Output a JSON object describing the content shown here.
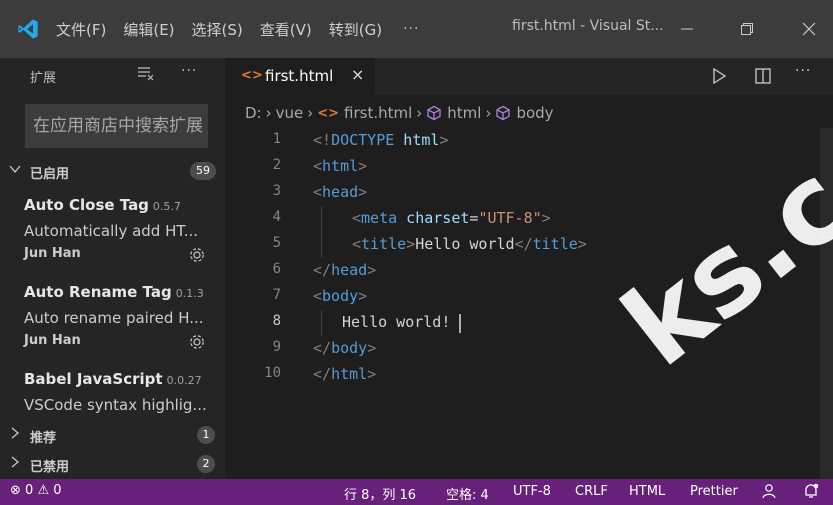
{
  "titlebar": {
    "menus": [
      "文件(F)",
      "编辑(E)",
      "选择(S)",
      "查看(V)",
      "转到(G)"
    ],
    "more": "···",
    "window_title": "first.html - Visual St...",
    "colors": {
      "background": "#3c3c3c",
      "logo": "#23a9f2"
    }
  },
  "sidebar": {
    "title": "扩展",
    "more": "···",
    "search_placeholder": "在应用商店中搜索扩展",
    "enabled_section": {
      "label": "已启用",
      "count": "59"
    },
    "extensions": [
      {
        "name": "Auto Close Tag",
        "version": "0.5.7",
        "description": "Automatically add HT...",
        "publisher": "Jun Han"
      },
      {
        "name": "Auto Rename Tag",
        "version": "0.1.3",
        "description": "Auto rename paired H...",
        "publisher": "Jun Han"
      },
      {
        "name": "Babel JavaScript",
        "version": "0.0.27",
        "description": "VSCode syntax highlig...",
        "publisher": ""
      }
    ],
    "recommended_section": {
      "label": "推荐",
      "count": "1"
    },
    "disabled_section": {
      "label": "已禁用",
      "count": "2"
    }
  },
  "tab": {
    "label": "first.html",
    "icon": "<>",
    "close": "×"
  },
  "breadcrumb": {
    "drive": "D:",
    "folder": "vue",
    "file": "first.html",
    "html": "html",
    "body": "body"
  },
  "editor": {
    "line_numbers": [
      "1",
      "2",
      "3",
      "4",
      "5",
      "6",
      "7",
      "8",
      "9",
      "10"
    ],
    "lines": {
      "l1_open": "<!",
      "l1_doctype": "DOCTYPE",
      "l1_html": " html",
      "l1_close": ">",
      "l2_open": "<",
      "l2_tag": "html",
      "l2_close": ">",
      "l3_open": "<",
      "l3_tag": "head",
      "l3_close": ">",
      "l4_open": "<",
      "l4_tag": "meta",
      "l4_attr": " charset",
      "l4_eq": "=",
      "l4_val": "\"UTF-8\"",
      "l4_close": ">",
      "l5_open": "<",
      "l5_tag": "title",
      "l5_close": ">",
      "l5_text": "Hello world",
      "l5_endopen": "</",
      "l5_endtag": "title",
      "l5_endclose": ">",
      "l6_open": "</",
      "l6_tag": "head",
      "l6_close": ">",
      "l7_open": "<",
      "l7_tag": "body",
      "l7_close": ">",
      "l8_text": "Hello world!",
      "l9_open": "</",
      "l9_tag": "body",
      "l9_close": ">",
      "l10_open": "</",
      "l10_tag": "html",
      "l10_close": ">"
    }
  },
  "statusbar": {
    "errors": "0",
    "warnings": "0",
    "position": "行 8，列 16",
    "spaces": "空格: 4",
    "encoding": "UTF-8",
    "eol": "CRLF",
    "language": "HTML",
    "formatter": "Prettier",
    "colors": {
      "background": "#68217a"
    }
  },
  "watermark": {
    "text": "ks.c"
  }
}
